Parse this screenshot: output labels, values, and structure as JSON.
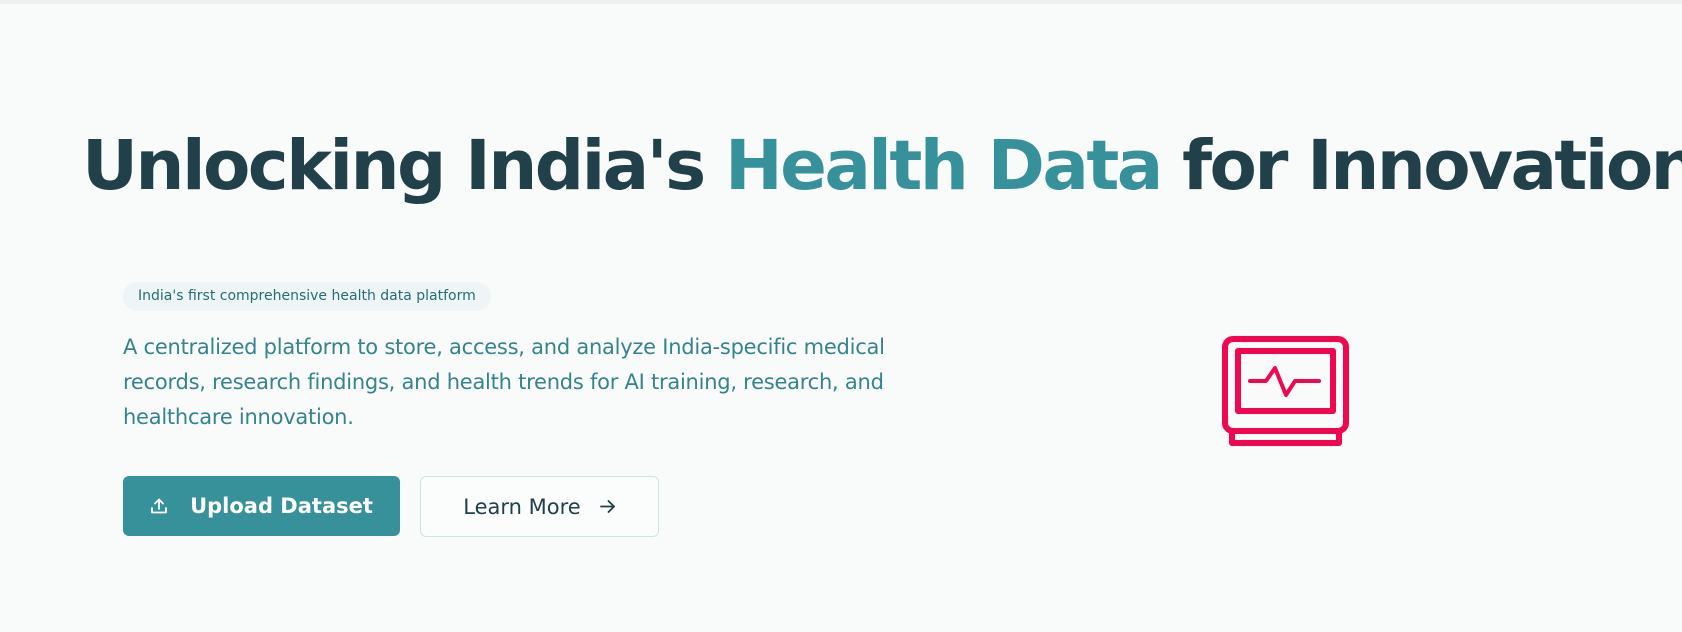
{
  "hero": {
    "title_part1": "Unlocking India's ",
    "title_accent": "Health Data",
    "title_part2": " for Innovation",
    "badge": "India's first comprehensive health data platform",
    "description": "A centralized platform to store, access, and analyze India-specific medical records, research findings, and health trends for AI training, research, and healthcare innovation."
  },
  "actions": {
    "upload_label": "Upload Dataset",
    "upload_icon": "upload-icon",
    "learn_more_label": "Learn More",
    "learn_more_icon": "arrow-right-icon"
  },
  "illustration": {
    "icon": "heart-monitor-icon"
  },
  "colors": {
    "heading": "#22404a",
    "accent": "#37919a",
    "primary_button": "#37919a",
    "monitor_icon": "#f0074f",
    "background": "#f9fbfb"
  }
}
